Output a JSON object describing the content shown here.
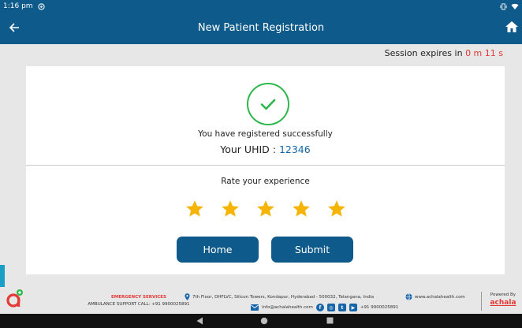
{
  "status_bar": {
    "time": "1:16 pm"
  },
  "header": {
    "title": "New Patient Registration"
  },
  "session": {
    "label": "Session expires in",
    "timer": "0 m 11 s"
  },
  "success": {
    "message": "You have registered successfully",
    "uhid_label": "Your UHID :",
    "uhid_value": "12346"
  },
  "rating": {
    "label": "Rate your experience",
    "value": 5,
    "max": 5
  },
  "buttons": {
    "home": "Home",
    "submit": "Submit"
  },
  "footer": {
    "emergency_title": "EMERGENCY SERVICES",
    "ambulance": "AMBULANCE SUPPORT CALL: +91 9900025891",
    "address": "7th Floor, DHFLVC, Silicon Towers, Kondapur, Hyderabad - 500032, Telangana, India",
    "email": "info@achalahealth.com",
    "phone": "+91 9900025891",
    "website": "www.achalahealth.com",
    "powered_label": "Powered By",
    "brand": "achala"
  },
  "colors": {
    "primary": "#0e5a8a",
    "success": "#2db84c",
    "star": "#f5b400",
    "timer": "#e53935"
  }
}
